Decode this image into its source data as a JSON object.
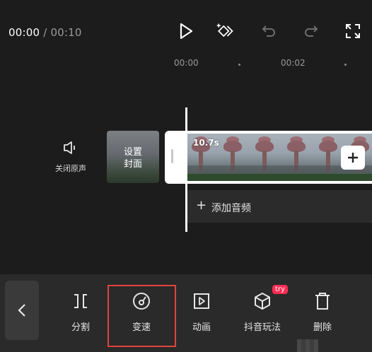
{
  "player": {
    "current_time": "00:00",
    "separator": "/",
    "duration": "00:10"
  },
  "ruler": {
    "ticks": [
      "00:00",
      "00:02"
    ]
  },
  "track": {
    "mute_label": "关闭原声",
    "cover_label_line1": "设置",
    "cover_label_line2": "封面",
    "clip_duration": "10.7s",
    "add_audio_label": "添加音频"
  },
  "toolbar": {
    "items": [
      {
        "label": "分割",
        "icon": "split-icon"
      },
      {
        "label": "变速",
        "icon": "speed-icon",
        "selected": true
      },
      {
        "label": "动画",
        "icon": "animation-icon"
      },
      {
        "label": "抖音玩法",
        "icon": "cube-icon",
        "badge": "try"
      },
      {
        "label": "删除",
        "icon": "trash-icon"
      }
    ]
  },
  "colors": {
    "background": "#1c1c1c",
    "toolbar": "#2a2a2a",
    "highlight": "#e0443e",
    "try_badge": "#fe2c55"
  }
}
